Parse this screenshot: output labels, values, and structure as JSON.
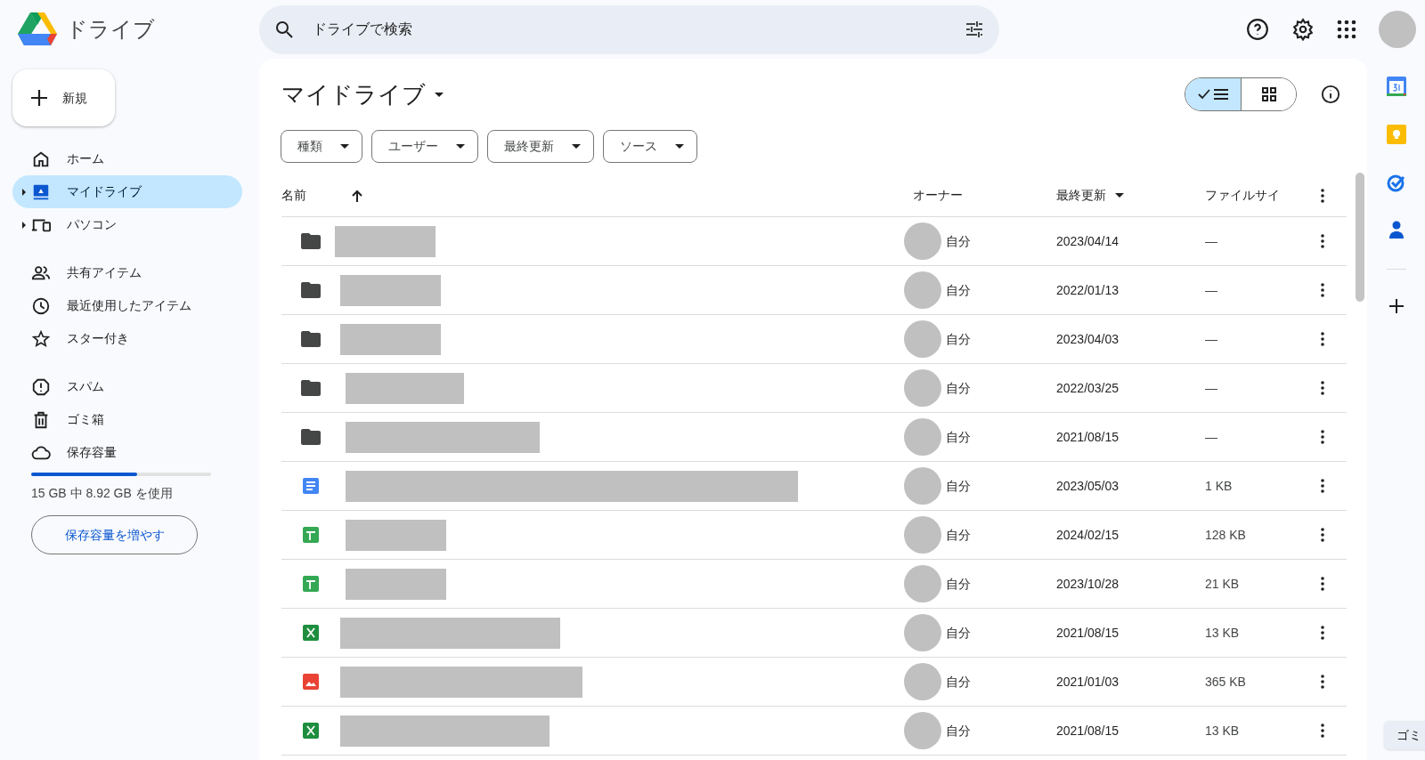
{
  "app": {
    "title": "ドライブ"
  },
  "search": {
    "placeholder": "ドライブで検索"
  },
  "new_button": {
    "label": "新規"
  },
  "sidebar": {
    "groups": [
      [
        {
          "kind": "home",
          "label": "ホーム",
          "selected": false,
          "expandable": false
        },
        {
          "kind": "mydrive",
          "label": "マイドライブ",
          "selected": true,
          "expandable": true
        },
        {
          "kind": "computers",
          "label": "パソコン",
          "selected": false,
          "expandable": true
        }
      ],
      [
        {
          "kind": "shared",
          "label": "共有アイテム",
          "selected": false,
          "expandable": false
        },
        {
          "kind": "recent",
          "label": "最近使用したアイテム",
          "selected": false,
          "expandable": false
        },
        {
          "kind": "starred",
          "label": "スター付き",
          "selected": false,
          "expandable": false
        }
      ],
      [
        {
          "kind": "spam",
          "label": "スパム",
          "selected": false,
          "expandable": false
        },
        {
          "kind": "trash",
          "label": "ゴミ箱",
          "selected": false,
          "expandable": false
        },
        {
          "kind": "storage",
          "label": "保存容量",
          "selected": false,
          "expandable": false
        }
      ]
    ]
  },
  "storage": {
    "level": 0.59,
    "text": "15 GB 中 8.92 GB を使用",
    "button": "保存容量を増やす"
  },
  "main": {
    "title": "マイドライブ",
    "view_toggle": [
      {
        "kind": "list",
        "selected": true
      },
      {
        "kind": "grid",
        "selected": false
      }
    ],
    "filters": [
      "種類",
      "ユーザー",
      "最終更新",
      "ソース"
    ],
    "columns": [
      {
        "label": "名前",
        "kind": "ascending"
      },
      {
        "label": "オーナー",
        "kind": "plain"
      },
      {
        "label": "最終更新",
        "kind": "descending"
      },
      {
        "label": "ファイルサイ",
        "kind": "plain"
      }
    ],
    "rows": [
      {
        "kind": "folder",
        "owner": "自分",
        "modified": "2023/04/14",
        "size": "—"
      },
      {
        "kind": "folder",
        "owner": "自分",
        "modified": "2022/01/13",
        "size": "—"
      },
      {
        "kind": "folder",
        "owner": "自分",
        "modified": "2023/04/03",
        "size": "—"
      },
      {
        "kind": "folder",
        "owner": "自分",
        "modified": "2022/03/25",
        "size": "—"
      },
      {
        "kind": "folder",
        "owner": "自分",
        "modified": "2021/08/15",
        "size": "—"
      },
      {
        "kind": "doc",
        "owner": "自分",
        "modified": "2023/05/03",
        "size": "1 KB"
      },
      {
        "kind": "sheet",
        "owner": "自分",
        "modified": "2024/02/15",
        "size": "128 KB"
      },
      {
        "kind": "sheet",
        "owner": "自分",
        "modified": "2023/10/28",
        "size": "21 KB"
      },
      {
        "kind": "excel",
        "owner": "自分",
        "modified": "2021/08/15",
        "size": "13 KB"
      },
      {
        "kind": "image",
        "owner": "自分",
        "modified": "2021/01/03",
        "size": "365 KB"
      },
      {
        "kind": "excel",
        "owner": "自分",
        "modified": "2021/08/15",
        "size": "13 KB"
      }
    ]
  },
  "tooltip": {
    "text": "ゴミ"
  }
}
